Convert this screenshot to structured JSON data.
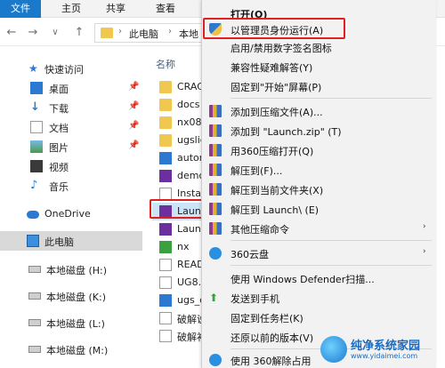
{
  "ribbon": {
    "tabs": [
      "文件",
      "主页",
      "共享",
      "查看"
    ]
  },
  "address": {
    "back": "←",
    "forward": "→",
    "dropdown": "∨",
    "up": "↑",
    "crumbs": [
      "此电脑",
      "本地"
    ]
  },
  "navpane": {
    "items": [
      {
        "label": "快速访问",
        "icon": "star-icon"
      },
      {
        "label": "桌面",
        "icon": "desktop-icon",
        "pinned": true
      },
      {
        "label": "下载",
        "icon": "download-icon",
        "pinned": true
      },
      {
        "label": "文档",
        "icon": "documents-icon",
        "pinned": true
      },
      {
        "label": "图片",
        "icon": "pictures-icon",
        "pinned": true
      },
      {
        "label": "视频",
        "icon": "videos-icon"
      },
      {
        "label": "音乐",
        "icon": "music-icon"
      },
      {
        "label": "OneDrive",
        "icon": "cloud-icon"
      },
      {
        "label": "此电脑",
        "icon": "this-pc-icon"
      },
      {
        "label": "本地磁盘 (H:)",
        "icon": "drive-icon"
      },
      {
        "label": "本地磁盘 (K:)",
        "icon": "drive-icon"
      },
      {
        "label": "本地磁盘 (L:)",
        "icon": "drive-icon"
      },
      {
        "label": "本地磁盘 (M:)",
        "icon": "drive-icon"
      }
    ],
    "pin_glyph": "📌"
  },
  "filelist": {
    "column_header": "名称",
    "items": [
      {
        "label": "CRAC",
        "type": "folder"
      },
      {
        "label": "docs",
        "type": "folder"
      },
      {
        "label": "nx080",
        "type": "folder"
      },
      {
        "label": "ugslic",
        "type": "folder"
      },
      {
        "label": "autor",
        "type": "app"
      },
      {
        "label": "demo",
        "type": "app"
      },
      {
        "label": "Instal",
        "type": "doc"
      },
      {
        "label": "Launc",
        "type": "launch"
      },
      {
        "label": "Launc",
        "type": "launch"
      },
      {
        "label": "nx",
        "type": "app"
      },
      {
        "label": "READ",
        "type": "doc"
      },
      {
        "label": "UG8.0",
        "type": "doc"
      },
      {
        "label": "ugs_c",
        "type": "app"
      },
      {
        "label": "破解说",
        "type": "doc"
      },
      {
        "label": "破解补",
        "type": "doc"
      }
    ]
  },
  "context_menu": {
    "items": [
      {
        "label": "打开(O)",
        "bold": true
      },
      {
        "label": "以管理员身份运行(A)",
        "icon": "shield-icon"
      },
      {
        "label": "启用/禁用数字签名图标"
      },
      {
        "label": "兼容性疑难解答(Y)"
      },
      {
        "label": "固定到\"开始\"屏幕(P)"
      },
      {
        "label": "添加到压缩文件(A)...",
        "icon": "archive-icon"
      },
      {
        "label": "添加到 \"Launch.zip\" (T)",
        "icon": "archive-icon"
      },
      {
        "label": "用360压缩打开(Q)",
        "icon": "archive-icon"
      },
      {
        "label": "解压到(F)...",
        "icon": "archive-icon"
      },
      {
        "label": "解压到当前文件夹(X)",
        "icon": "archive-icon"
      },
      {
        "label": "解压到 Launch\\ (E)",
        "icon": "archive-icon"
      },
      {
        "label": "其他压缩命令",
        "icon": "archive-icon",
        "submenu": true
      },
      {
        "label": "360云盘",
        "icon": "cloud-360-icon",
        "submenu": true
      },
      {
        "label": "使用 Windows Defender扫描..."
      },
      {
        "label": "发送到手机",
        "icon": "send-phone-icon"
      },
      {
        "label": "固定到任务栏(K)"
      },
      {
        "label": "还原以前的版本(V)"
      },
      {
        "label": "使用 360解除占用",
        "icon": "360-icon"
      }
    ],
    "submenu_glyph": "›"
  },
  "watermark": {
    "title": "纯净系统家园",
    "url": "www.yidaimei.com"
  },
  "colors": {
    "highlight": "#e02020",
    "file_tab": "#1979ca"
  }
}
